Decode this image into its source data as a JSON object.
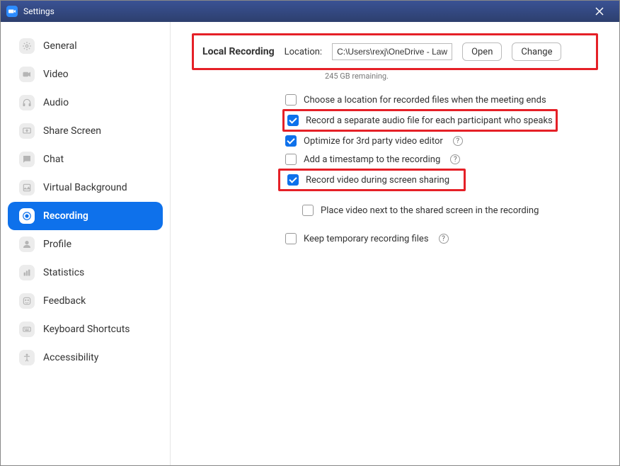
{
  "window": {
    "title": "Settings"
  },
  "sidebar": {
    "items": [
      {
        "label": "General"
      },
      {
        "label": "Video"
      },
      {
        "label": "Audio"
      },
      {
        "label": "Share Screen"
      },
      {
        "label": "Chat"
      },
      {
        "label": "Virtual Background"
      },
      {
        "label": "Recording"
      },
      {
        "label": "Profile"
      },
      {
        "label": "Statistics"
      },
      {
        "label": "Feedback"
      },
      {
        "label": "Keyboard Shortcuts"
      },
      {
        "label": "Accessibility"
      }
    ]
  },
  "recording": {
    "section_title": "Local Recording",
    "location_label": "Location:",
    "location_value": "C:\\Users\\rexj\\OneDrive - Lawren",
    "open_button": "Open",
    "change_button": "Change",
    "remaining": "245 GB remaining.",
    "options": {
      "choose_location": "Choose a location for recorded files when the meeting ends",
      "separate_audio": "Record a separate audio file for each participant who speaks",
      "optimize_editor": "Optimize for 3rd party video editor",
      "add_timestamp": "Add a timestamp to the recording",
      "record_video_share": "Record video during screen sharing",
      "place_video_next": "Place video next to the shared screen in the recording",
      "keep_temp": "Keep temporary recording files"
    }
  }
}
